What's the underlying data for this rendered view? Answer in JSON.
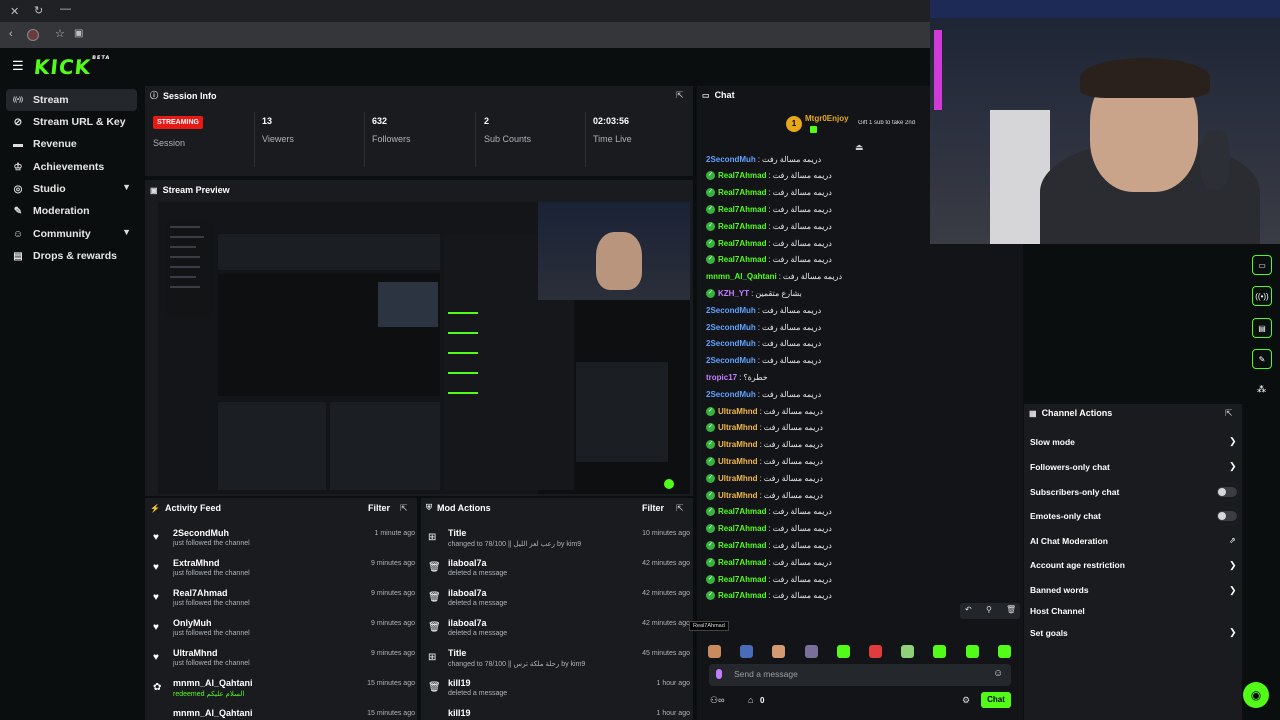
{
  "browser": {
    "close_glyph": "✕",
    "reload_glyph": "↻",
    "minimize_glyph": "—"
  },
  "brand": {
    "logo": "KICK",
    "logo_sup": "BETA",
    "accent": "#53fc18"
  },
  "sidebar": {
    "items": [
      {
        "label": "Stream",
        "icon": "broadcast-icon",
        "glyph": "((•))"
      },
      {
        "label": "Stream URL & Key",
        "icon": "link-icon",
        "glyph": "🔗"
      },
      {
        "label": "Revenue",
        "icon": "money-icon",
        "glyph": "$"
      },
      {
        "label": "Achievements",
        "icon": "trophy-icon",
        "glyph": "🏆"
      },
      {
        "label": "Studio",
        "icon": "studio-icon",
        "glyph": "◎"
      },
      {
        "label": "Moderation",
        "icon": "wrench-icon",
        "glyph": "🔧"
      },
      {
        "label": "Community",
        "icon": "community-icon",
        "glyph": "☺"
      },
      {
        "label": "Drops & rewards",
        "icon": "drops-icon",
        "glyph": "▤"
      }
    ]
  },
  "session": {
    "title": "Session Info",
    "status_badge": "STREAMING",
    "session_label": "Session",
    "stats": [
      {
        "value": "13",
        "label": "Viewers"
      },
      {
        "value": "632",
        "label": "Followers"
      },
      {
        "value": "2",
        "label": "Sub Counts"
      },
      {
        "value": "02:03:56",
        "label": "Time Live"
      }
    ]
  },
  "preview": {
    "title": "Stream Preview"
  },
  "activity": {
    "title": "Activity Feed",
    "filter": "Filter",
    "rows": [
      {
        "name": "2SecondMuh",
        "sub": "just followed the channel",
        "time": "1 minute ago",
        "icon": "heart-icon"
      },
      {
        "name": "ExtraMhnd",
        "sub": "just followed the channel",
        "time": "9 minutes ago",
        "icon": "heart-icon"
      },
      {
        "name": "Real7Ahmad",
        "sub": "just followed the channel",
        "time": "9 minutes ago",
        "icon": "heart-icon"
      },
      {
        "name": "OnlyMuh",
        "sub": "just followed the channel",
        "time": "9 minutes ago",
        "icon": "heart-icon"
      },
      {
        "name": "UltraMhnd",
        "sub": "just followed the channel",
        "time": "9 minutes ago",
        "icon": "heart-icon"
      },
      {
        "name": "mnmn_Al_Qahtani",
        "sub": "redeemed السلام عليكم",
        "time": "15 minutes ago",
        "icon": "reward-icon"
      },
      {
        "name": "mnmn_Al_Qahtani",
        "sub": "",
        "time": "15 minutes ago",
        "icon": "reward-icon"
      }
    ]
  },
  "mod": {
    "title": "Mod Actions",
    "filter": "Filter",
    "rows": [
      {
        "name": "Title",
        "sub": "changed to 78/100 || رعب لعز الليل by kim9",
        "time": "10 minutes ago",
        "icon": "title-icon"
      },
      {
        "name": "ilaboal7a",
        "sub": "deleted a message",
        "time": "42 minutes ago",
        "icon": "trash-icon"
      },
      {
        "name": "ilaboal7a",
        "sub": "deleted a message",
        "time": "42 minutes ago",
        "icon": "trash-icon"
      },
      {
        "name": "ilaboal7a",
        "sub": "deleted a message",
        "time": "42 minutes ago",
        "icon": "trash-icon"
      },
      {
        "name": "Title",
        "sub": "changed to 78/100 || رحلة ملكة ترس by kim9",
        "time": "45 minutes ago",
        "icon": "title-icon"
      },
      {
        "name": "kill19",
        "sub": "deleted a message",
        "time": "1 hour ago",
        "icon": "trash-icon"
      },
      {
        "name": "kill19",
        "sub": "",
        "time": "1 hour ago",
        "icon": "trash-icon"
      }
    ]
  },
  "chat": {
    "title": "Chat",
    "pinned_user": "Mtgr0Enjoy",
    "pinned_rank": "1",
    "pinned_text": "Gift 1 sub to take 2nd",
    "input_placeholder": "Send a message",
    "user_count": "0",
    "chat_button": "Chat",
    "tooltip": "Real7Ahmad",
    "messages": [
      {
        "user": "2SecondMuh",
        "text": "دريمه مسالة رفت",
        "color": "#5ea1ff",
        "badge": false
      },
      {
        "user": "Real7Ahmad",
        "text": "دريمه مسالة رفت",
        "color": "#53fc18",
        "badge": true
      },
      {
        "user": "Real7Ahmad",
        "text": "دريمه مسالة رفت",
        "color": "#53fc18",
        "badge": true
      },
      {
        "user": "Real7Ahmad",
        "text": "دريمه مسالة رفت",
        "color": "#53fc18",
        "badge": true
      },
      {
        "user": "Real7Ahmad",
        "text": "دريمه مسالة رفت",
        "color": "#53fc18",
        "badge": true
      },
      {
        "user": "Real7Ahmad",
        "text": "دريمه مسالة رفت",
        "color": "#53fc18",
        "badge": true
      },
      {
        "user": "Real7Ahmad",
        "text": "دريمه مسالة رفت",
        "color": "#53fc18",
        "badge": true
      },
      {
        "user": "mnmn_Al_Qahtani",
        "text": "دريمه مسالة رفت",
        "color": "#53fc18",
        "badge": false
      },
      {
        "user": "KZH_YT",
        "text": "بشارع متقمين",
        "color": "#c47dff",
        "badge": true
      },
      {
        "user": "2SecondMuh",
        "text": "دريمه مسالة رفت",
        "color": "#5ea1ff",
        "badge": false
      },
      {
        "user": "2SecondMuh",
        "text": "دريمه مسالة رفت",
        "color": "#5ea1ff",
        "badge": false
      },
      {
        "user": "2SecondMuh",
        "text": "دريمه مسالة رفت",
        "color": "#5ea1ff",
        "badge": false
      },
      {
        "user": "2SecondMuh",
        "text": "دريمه مسالة رفت",
        "color": "#5ea1ff",
        "badge": false
      },
      {
        "user": "tropic17",
        "text": "خطرة؟",
        "color": "#c47dff",
        "badge": false
      },
      {
        "user": "2SecondMuh",
        "text": "دريمه مسالة رفت",
        "color": "#5ea1ff",
        "badge": false
      },
      {
        "user": "UltraMhnd",
        "text": "دريمه مسالة رفت",
        "color": "#f2b84b",
        "badge": true
      },
      {
        "user": "UltraMhnd",
        "text": "دريمه مسالة رفت",
        "color": "#f2b84b",
        "badge": true
      },
      {
        "user": "UltraMhnd",
        "text": "دريمه مسالة رفت",
        "color": "#f2b84b",
        "badge": true
      },
      {
        "user": "UltraMhnd",
        "text": "دريمه مسالة رفت",
        "color": "#f2b84b",
        "badge": true
      },
      {
        "user": "UltraMhnd",
        "text": "دريمه مسالة رفت",
        "color": "#f2b84b",
        "badge": true
      },
      {
        "user": "UltraMhnd",
        "text": "دريمه مسالة رفت",
        "color": "#f2b84b",
        "badge": true
      },
      {
        "user": "Real7Ahmad",
        "text": "دريمه مسالة رفت",
        "color": "#53fc18",
        "badge": true
      },
      {
        "user": "Real7Ahmad",
        "text": "دريمه مسالة رفت",
        "color": "#53fc18",
        "badge": true
      },
      {
        "user": "Real7Ahmad",
        "text": "دريمه مسالة رفت",
        "color": "#53fc18",
        "badge": true
      },
      {
        "user": "Real7Ahmad",
        "text": "دريمه مسالة رفت",
        "color": "#53fc18",
        "badge": true
      },
      {
        "user": "Real7Ahmad",
        "text": "دريمه مسالة رفت",
        "color": "#53fc18",
        "badge": true
      },
      {
        "user": "Real7Ahmad",
        "text": "دريمه مسالة رفت",
        "color": "#53fc18",
        "badge": true
      }
    ]
  },
  "channel_actions": {
    "title": "Channel Actions",
    "items": [
      {
        "label": "Slow mode",
        "control": "chevron"
      },
      {
        "label": "Followers-only chat",
        "control": "chevron"
      },
      {
        "label": "Subscribers-only chat",
        "control": "toggle"
      },
      {
        "label": "Emotes-only chat",
        "control": "toggle"
      },
      {
        "label": "AI Chat Moderation",
        "control": "external"
      },
      {
        "label": "Account age restriction",
        "control": "chevron"
      },
      {
        "label": "Banned words",
        "control": "chevron"
      },
      {
        "label": "Host Channel",
        "control": "none"
      },
      {
        "label": "Set goals",
        "control": "chevron"
      }
    ]
  }
}
